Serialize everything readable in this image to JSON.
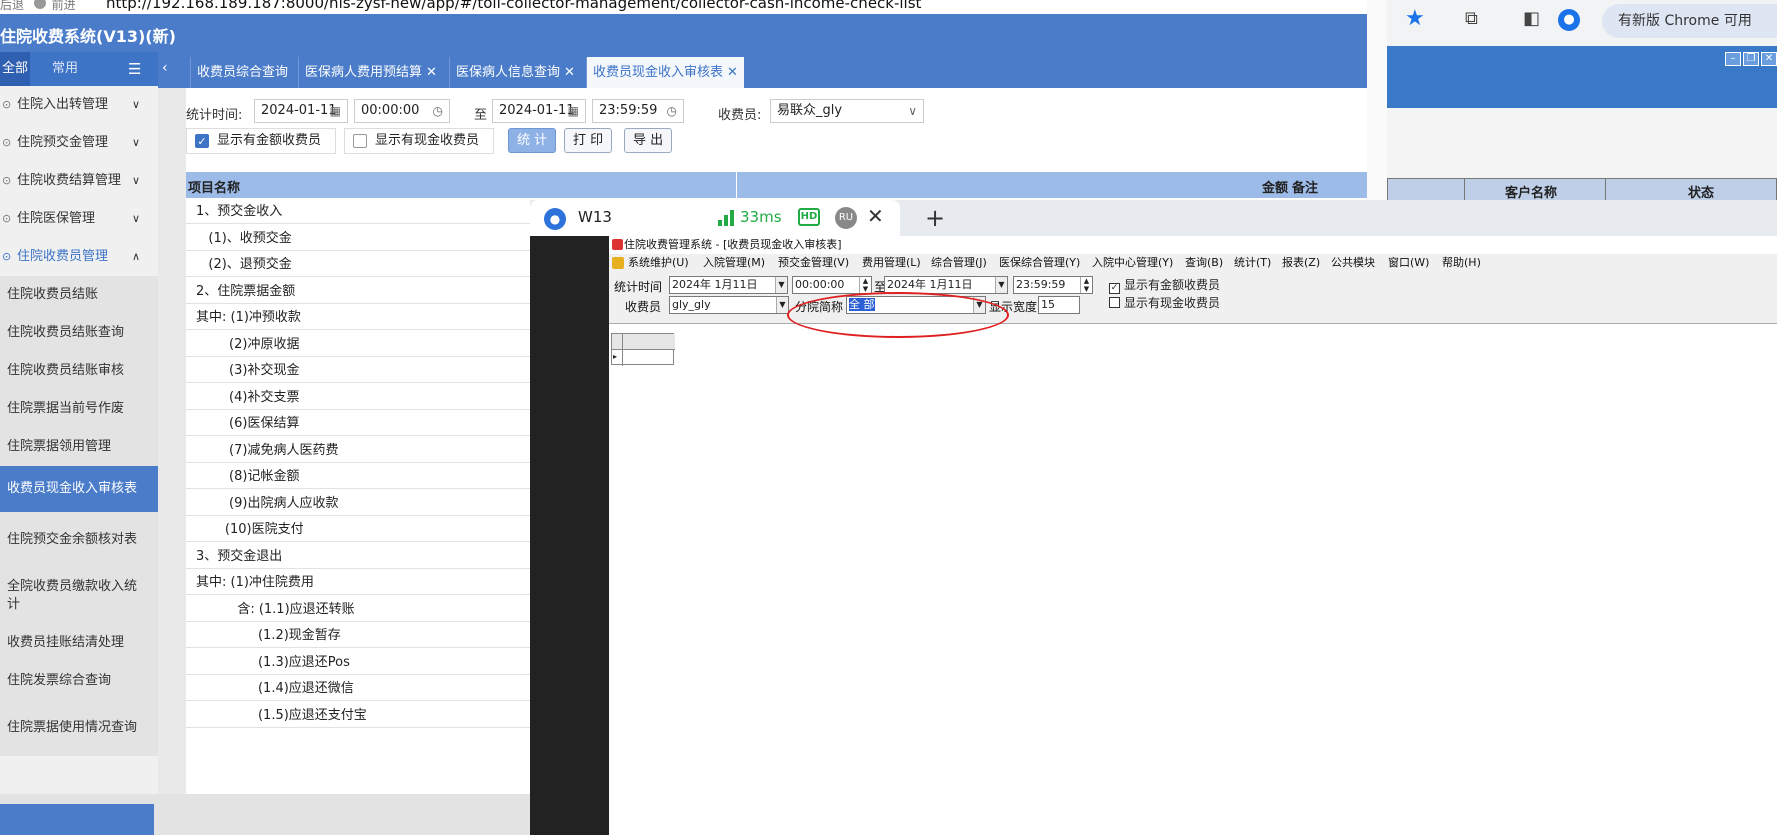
{
  "browser": {
    "back_label": "后退",
    "forward_label": "前进",
    "url": "http://192.168.189.187:8000/his-zysf-new/app/#/toll-collector-management/collector-cash-income-check-list"
  },
  "app": {
    "title": "住院收费系统(V13)(新)"
  },
  "sidebar": {
    "tab_all": "全部",
    "tab_common": "常用",
    "groups": [
      {
        "label": "住院入出转管理"
      },
      {
        "label": "住院预交金管理"
      },
      {
        "label": "住院收费结算管理"
      },
      {
        "label": "住院医保管理"
      },
      {
        "label": "住院收费员管理"
      }
    ],
    "items": [
      {
        "label": "住院收费员结账"
      },
      {
        "label": "住院收费员结账查询"
      },
      {
        "label": "住院收费员结账审核"
      },
      {
        "label": "住院票据当前号作废"
      },
      {
        "label": "住院票据领用管理"
      },
      {
        "label": "收费员现金收入审核表"
      },
      {
        "label": "住院预交金余额核对表"
      },
      {
        "label": "全院收费员缴款收入统计"
      },
      {
        "label": "收费员挂账结清处理"
      },
      {
        "label": "住院发票综合查询"
      },
      {
        "label": "住院票据使用情况查询"
      }
    ]
  },
  "tabs": [
    {
      "label": "收费员综合查询"
    },
    {
      "label": "医保病人费用预结算"
    },
    {
      "label": "医保病人信息查询"
    },
    {
      "label": "收费员现金收入审核表"
    }
  ],
  "filters": {
    "stat_time_label": "统计时间:",
    "start_date": "2024-01-11",
    "start_time": "00:00:00",
    "to_label": "至",
    "end_date": "2024-01-11",
    "end_time": "23:59:59",
    "collector_label": "收费员:",
    "collector_value": "易联众_gly",
    "show_amount_label": "显示有金额收费员",
    "show_cash_label": "显示有现金收费员",
    "stat_button": "统 计",
    "print_button": "打 印",
    "export_button": "导 出"
  },
  "grid": {
    "col_item": "项目名称",
    "col_amount": "金额",
    "col_note": "备注",
    "rows": [
      "1、预交金收入",
      "   (1)、收预交金",
      "   (2)、退预交金",
      "2、住院票据金额",
      "其中: (1)冲预收款",
      "        (2)冲原收据",
      "        (3)补交现金",
      "        (4)补交支票",
      "        (6)医保结算",
      "        (7)减免病人医药费",
      "        (8)记帐金额",
      "        (9)出院病人应收款",
      "       (10)医院支付",
      "3、预交金退出",
      "其中: (1)冲住院费用",
      "          含: (1.1)应退还转账",
      "               (1.2)现金暂存",
      "               (1.3)应退还Pos",
      "               (1.4)应退还微信",
      "               (1.5)应退还支付宝"
    ]
  },
  "right_window": {
    "update_label": "有新版 Chrome 可用",
    "col_customer": "客户名称",
    "col_status": "状态"
  },
  "remote": {
    "tab_title": "W13",
    "latency": "33ms",
    "hd_label": "HD",
    "ru_label": "RU",
    "window_title": "住院收费管理系统 - [收费员现金收入审核表]",
    "menu": [
      "系统维护(U)",
      "入院管理(M)",
      "预交金管理(V)",
      "费用管理(L)",
      "综合管理(J)",
      "医保综合管理(Y)",
      "入院中心管理(Y)",
      "查询(B)",
      "统计(T)",
      "报表(Z)",
      "公共模块",
      "窗口(W)",
      "帮助(H)"
    ],
    "form": {
      "stat_time_label": "统计时间",
      "start_date": "2024年 1月11日",
      "start_time": "00:00:00",
      "to_label": "至",
      "end_date": "2024年 1月11日",
      "end_time": "23:59:59",
      "show_amount_label": "显示有金额收费员",
      "show_cash_label": "显示有现金收费员",
      "collector_label": "收费员",
      "collector_value": "gly_gly",
      "branch_label": "分院简称",
      "branch_value": "全 部",
      "width_label": "显示宽度",
      "width_value": "15"
    }
  },
  "colors": {
    "brand_blue": "#4a7cc9",
    "active_item": "#4a7cc9",
    "grid_header": "#9dbbe8",
    "latency_green": "#22aa44",
    "annotation_red": "#e02020"
  }
}
